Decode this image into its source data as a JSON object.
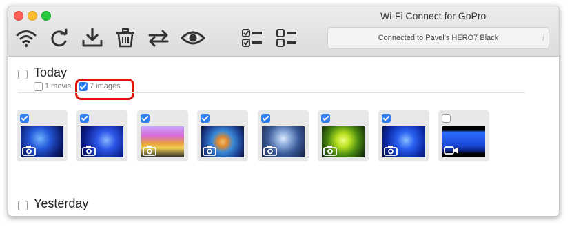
{
  "window": {
    "title": "Wi-Fi Connect for GoPro"
  },
  "toolbar": {
    "status_text": "Connected to Pavel's HERO7 Black",
    "status_info_glyph": "i",
    "icons": [
      "wifi-icon",
      "refresh-icon",
      "download-icon",
      "trash-icon",
      "sync-icon",
      "eye-icon",
      "select-all-icon",
      "deselect-all-icon"
    ]
  },
  "sections": {
    "today": {
      "title": "Today",
      "movies_label": "1 movie",
      "images_label": "7 images",
      "movies_checked": false,
      "images_checked": true,
      "checked": false
    },
    "yesterday": {
      "title": "Yesterday",
      "checked": false
    }
  },
  "media": [
    {
      "kind": "image",
      "checked": true
    },
    {
      "kind": "image",
      "checked": true
    },
    {
      "kind": "image",
      "checked": true
    },
    {
      "kind": "image",
      "checked": true
    },
    {
      "kind": "image",
      "checked": true
    },
    {
      "kind": "image",
      "checked": true
    },
    {
      "kind": "image",
      "checked": true
    },
    {
      "kind": "video",
      "checked": false
    }
  ],
  "colors": {
    "accent": "#2f7ff1",
    "highlight": "#e2150d"
  }
}
